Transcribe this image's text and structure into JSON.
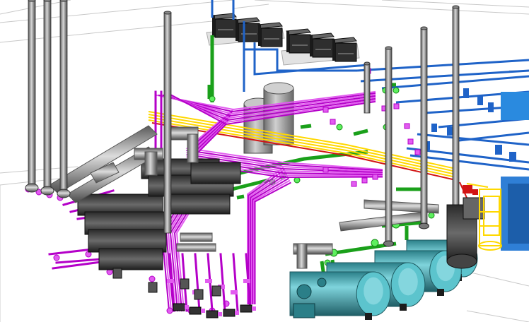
{
  "viewport": {
    "background": "#ffffff",
    "label": ""
  },
  "colors": {
    "steel_pipe": "#9a9a9a",
    "steel_pipe_dark": "#555555",
    "process_pipe": "#b400c8",
    "process_pipe_light": "#e25cf0",
    "water_pipe": "#1aa01a",
    "water_pipe_light": "#5ef05e",
    "blue_pipe": "#1f63c8",
    "yellow_tray": "#ffd800",
    "red_tray": "#d21414",
    "tank_teal": "#4fb5c0",
    "tank_teal_dark": "#2b7f88",
    "tank_gray": "#a9a9a9",
    "equipment_dark": "#3a3a3a",
    "gridline": "#c8c8c8"
  },
  "equipment": {
    "rooftop_units": 6,
    "vertical_stacks": 8,
    "horizontal_tanks": 4,
    "vertical_tanks": 2
  },
  "toolbar": {}
}
